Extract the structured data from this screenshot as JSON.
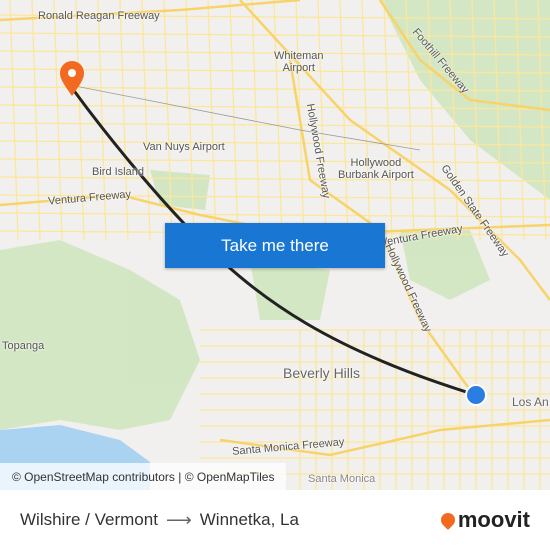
{
  "map": {
    "labels": {
      "ronald_reagan": "Ronald Reagan Freeway",
      "whiteman": "Whiteman\nAirport",
      "foothill": "Foothill Freeway",
      "hollywood_fwy": "Hollywood Freeway",
      "van_nuys": "Van Nuys Airport",
      "burbank": "Hollywood\nBurbank Airport",
      "bird_island": "Bird Island",
      "ventura": "Ventura Freeway",
      "golden_state": "Golden State Freeway",
      "ventura2": "Ventura Freeway",
      "hollywood_fwy2": "Hollywood Freeway",
      "topanga": "Topanga",
      "beverly_hills": "Beverly Hills",
      "los_angeles": "Los An",
      "santa_monica_fwy": "Santa Monica Freeway",
      "santa_monica": "Santa Monica"
    },
    "route_color": "#222222",
    "origin_marker_color": "#2a7de1",
    "destination_marker_color": "#f26a21",
    "cta_label": "Take me there",
    "cta_color": "#1976d2",
    "attribution": "© OpenStreetMap contributors | © OpenMapTiles"
  },
  "footer": {
    "origin": "Wilshire / Vermont",
    "arrow": "⟶",
    "destination": "Winnetka, La",
    "brand": "moovit"
  }
}
